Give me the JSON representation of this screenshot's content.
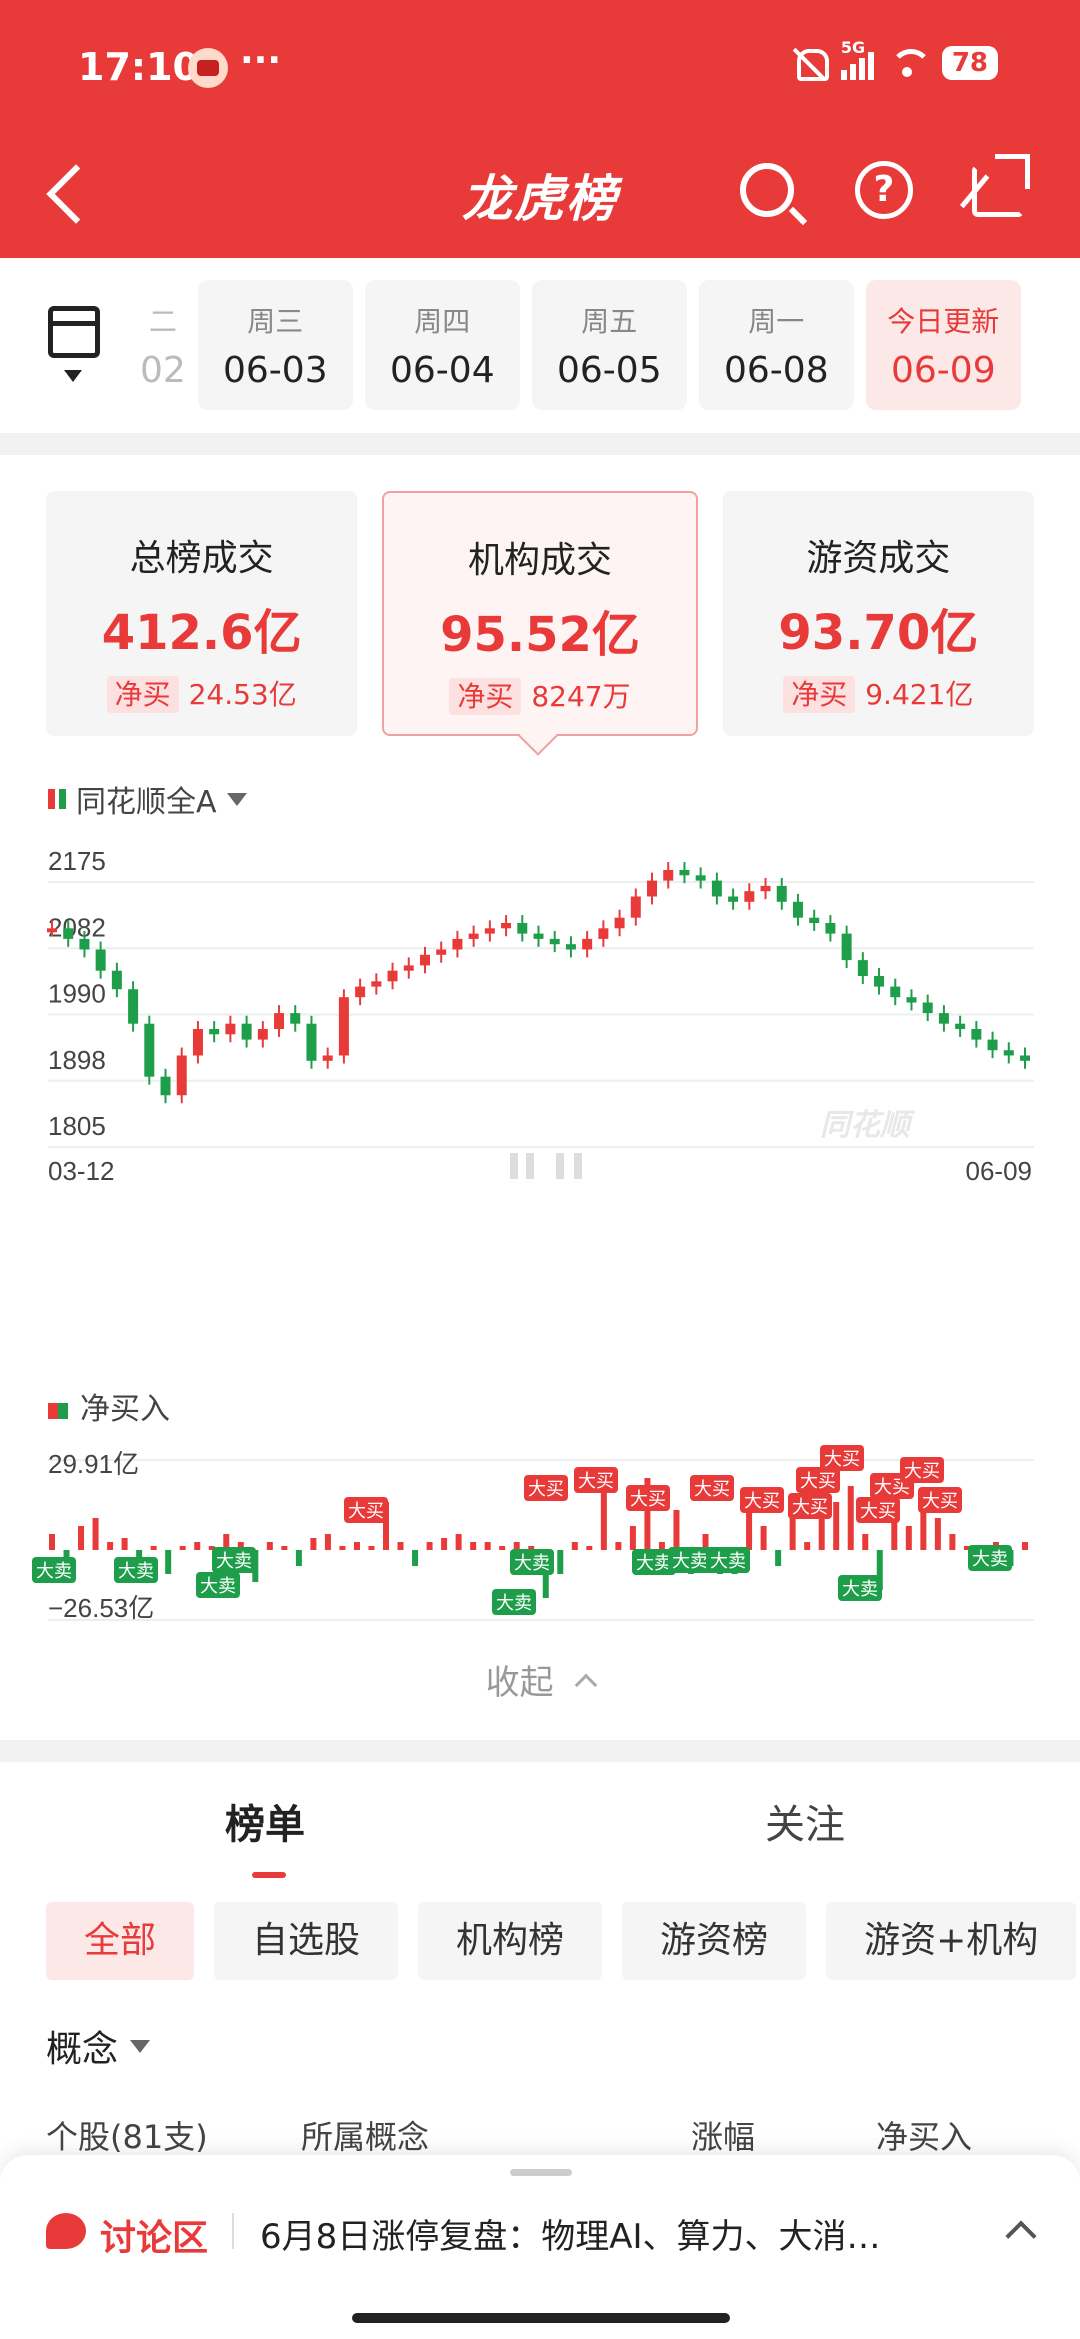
{
  "status": {
    "time": "17:10",
    "more": "···",
    "network": "5G",
    "battery": "78"
  },
  "header": {
    "title": "龙虎榜"
  },
  "dates": [
    {
      "weekday": "二",
      "date": "02",
      "partial": true
    },
    {
      "weekday": "周三",
      "date": "06-03"
    },
    {
      "weekday": "周四",
      "date": "06-04"
    },
    {
      "weekday": "周五",
      "date": "06-05"
    },
    {
      "weekday": "周一",
      "date": "06-08"
    },
    {
      "weekday": "今日更新",
      "date": "06-09",
      "active": true
    }
  ],
  "summaries": [
    {
      "name": "总榜成交",
      "value": "412.6亿",
      "net_label": "净买",
      "net": "24.53亿"
    },
    {
      "name": "机构成交",
      "value": "95.52亿",
      "net_label": "净买",
      "net": "8247万",
      "active": true
    },
    {
      "name": "游资成交",
      "value": "93.70亿",
      "net_label": "净买",
      "net": "9.421亿"
    }
  ],
  "index_selector": "同花顺全A",
  "kline": {
    "y_labels": [
      "2175",
      "2082",
      "1990",
      "1898",
      "1805"
    ],
    "x_start": "03-12",
    "x_end": "06-09",
    "watermark": "同花顺"
  },
  "net_buy": {
    "title": "净买入",
    "max_label": "29.91亿",
    "min_label": "−26.53亿",
    "big_buy": "大买",
    "big_sell": "大卖"
  },
  "collapse_label": "收起",
  "colors": {
    "brand": "#e93a3a",
    "up": "#e93a3a",
    "down": "#1e9e4a"
  },
  "lower": {
    "tabs": [
      "榜单",
      "关注"
    ],
    "filters": [
      "全部",
      "自选股",
      "机构榜",
      "游资榜",
      "游资+机构"
    ],
    "concept_label": "概念",
    "table_headers": [
      "个股(81支)",
      "所属概念",
      "涨幅",
      "净买入"
    ]
  },
  "discussion": {
    "label": "讨论区",
    "text": "6月8日涨停复盘：物理AI、算力、大消…"
  }
}
